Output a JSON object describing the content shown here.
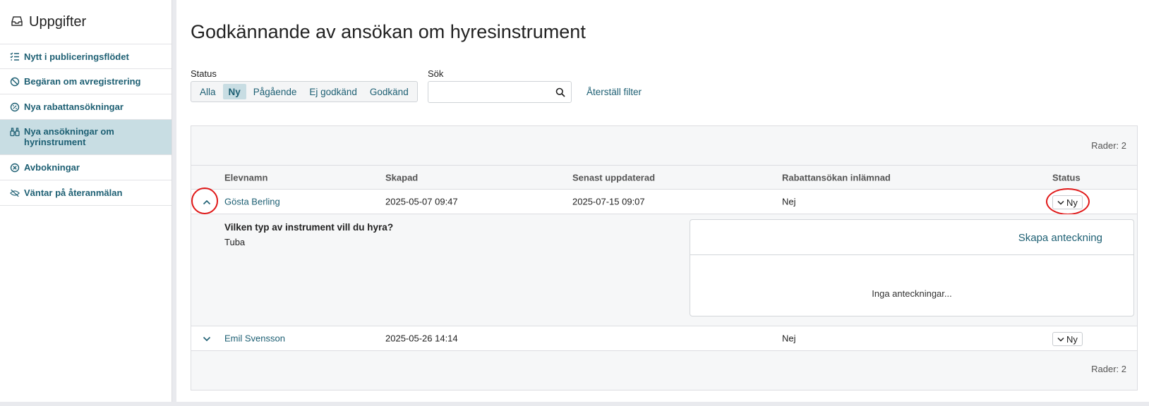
{
  "sidebar": {
    "title": "Uppgifter",
    "title_icon": "inbox-icon",
    "items": [
      {
        "label": "Nytt i publiceringsflödet",
        "icon": "list-check-icon",
        "active": false
      },
      {
        "label": "Begäran om avregistrering",
        "icon": "ban-icon",
        "active": false
      },
      {
        "label": "Nya rabattansökningar",
        "icon": "percent-icon",
        "active": false
      },
      {
        "label": "Nya ansökningar om hyrinstrument",
        "icon": "binoculars-icon",
        "active": true
      },
      {
        "label": "Avbokningar",
        "icon": "circle-x-icon",
        "active": false
      },
      {
        "label": "Väntar på återanmälan",
        "icon": "eye-slash-icon",
        "active": false
      }
    ]
  },
  "main": {
    "title": "Godkännande av ansökan om hyresinstrument",
    "filters": {
      "status_label": "Status",
      "status_options": [
        "Alla",
        "Ny",
        "Pågående",
        "Ej godkänd",
        "Godkänd"
      ],
      "status_selected": "Ny",
      "search_label": "Sök",
      "search_value": "",
      "search_placeholder": "",
      "reset_label": "Återställ filter"
    },
    "grid": {
      "rows_label_top": "Rader: 2",
      "rows_label_bottom": "Rader: 2",
      "columns": [
        "Elevnamn",
        "Skapad",
        "Senast uppdaterad",
        "Rabattansökan inlämnad",
        "Status"
      ],
      "rows": [
        {
          "name": "Gösta Berling",
          "created": "2025-05-07 09:47",
          "updated": "2025-07-15 09:07",
          "discount": "Nej",
          "status": "Ny",
          "expanded": true
        },
        {
          "name": "Emil Svensson",
          "created": "2025-05-26 14:14",
          "updated": "",
          "discount": "Nej",
          "status": "Ny",
          "expanded": false
        }
      ],
      "detail": {
        "question": "Vilken typ av instrument vill du hyra?",
        "answer": "Tuba",
        "notes_create": "Skapa anteckning",
        "notes_empty": "Inga anteckningar..."
      }
    }
  },
  "colors": {
    "accent": "#1d5f73",
    "active_bg": "#c8dde3",
    "annotation": "#e01818"
  }
}
